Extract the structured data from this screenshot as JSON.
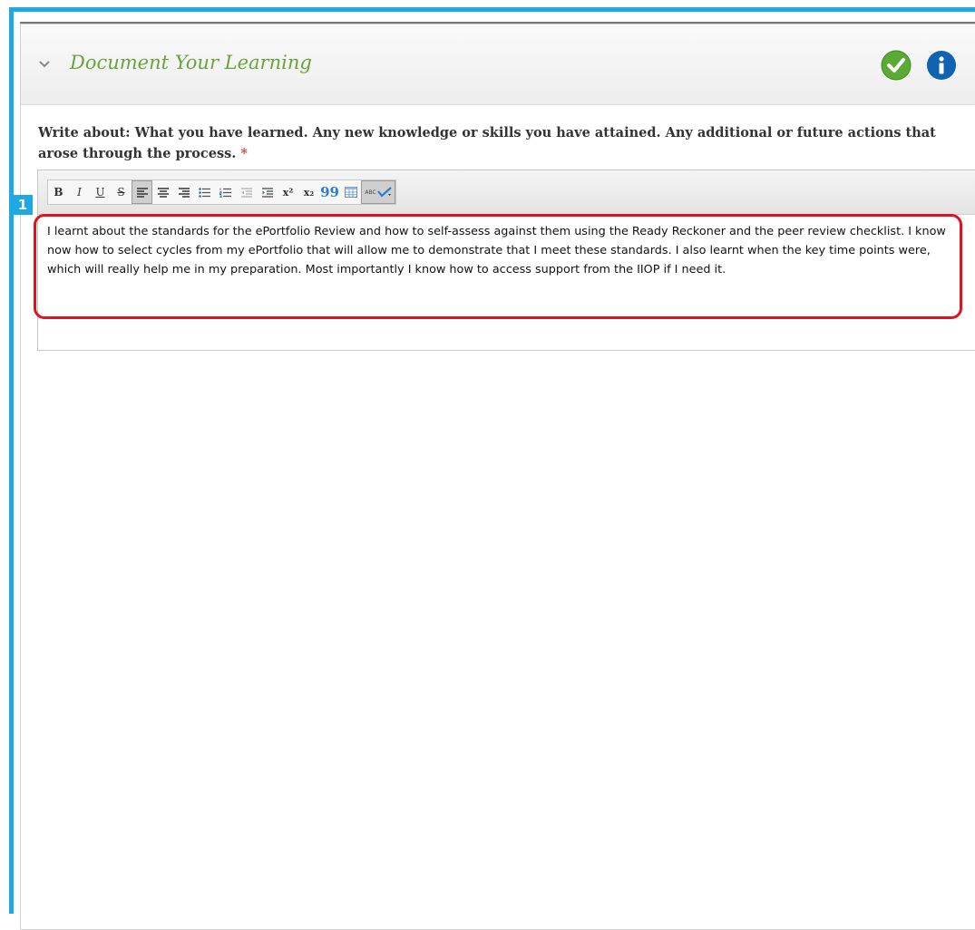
{
  "section": {
    "title": "Document Your Learning"
  },
  "prompt": {
    "text": "Write about: What you have learned. Any new knowledge or skills you have attained. Any additional or future actions that arose through the process.",
    "required_mark": "*"
  },
  "toolbar": {
    "bold": "B",
    "italic": "I",
    "underline": "U",
    "strikethrough": "S",
    "superscript": "x²",
    "subscript": "x₂",
    "quote": "99",
    "spellcheck": "ABC"
  },
  "annotation": {
    "marker": "1"
  },
  "editor": {
    "content": "I learnt about the standards for the ePortfolio Review and how to self-assess against them using the Ready Reckoner and the peer review checklist. I know now how to select cycles from my ePortfolio that will allow me to demonstrate that I meet these standards. I also learnt when the key time points were, which will really help me in my preparation. Most importantly I know how to access support from the IIOP if I need it."
  },
  "colors": {
    "accent_blue": "#1ea9e0",
    "title_green": "#6aa23b",
    "highlight_red": "#e0121c"
  }
}
